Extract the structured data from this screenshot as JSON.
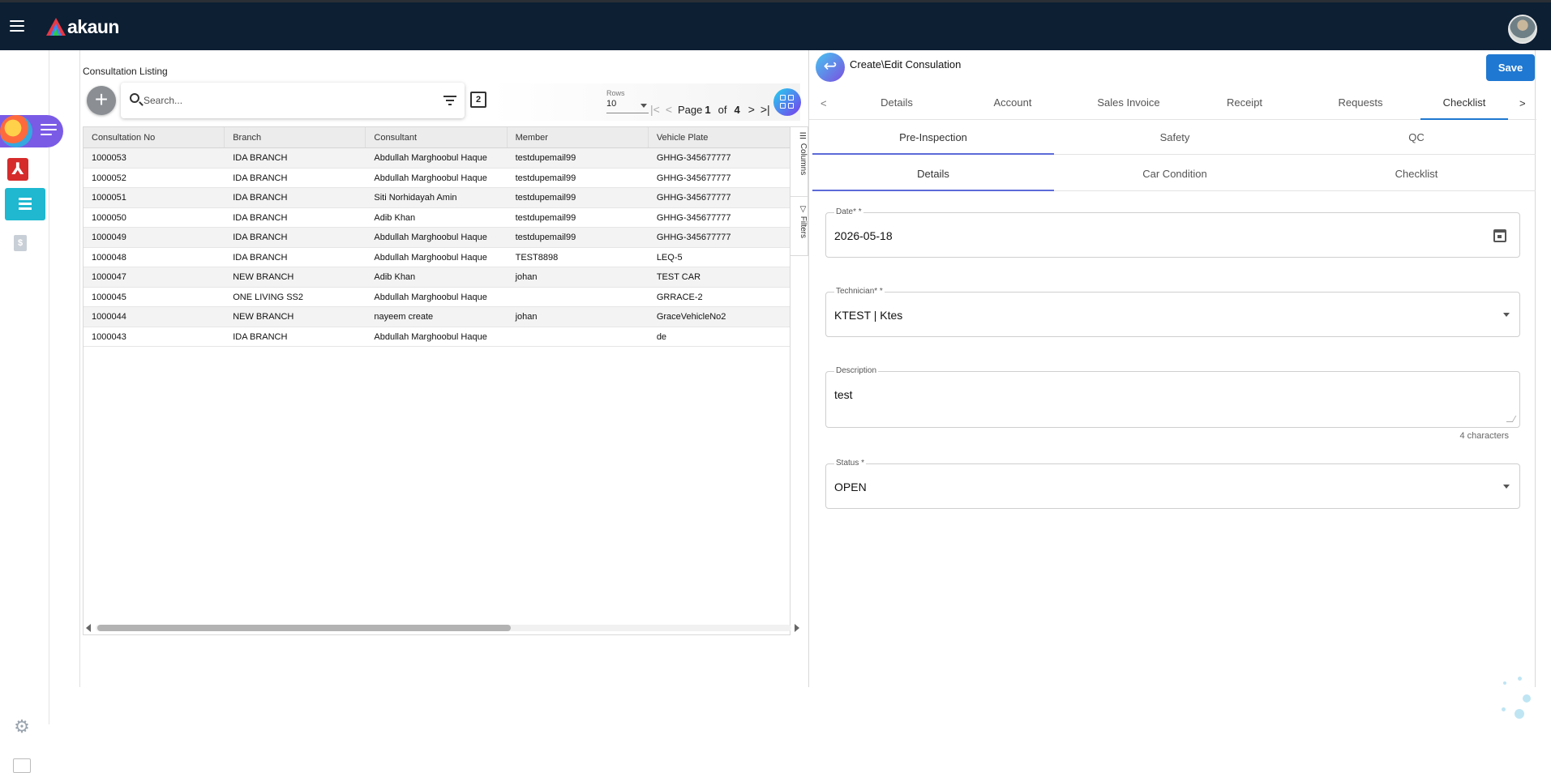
{
  "app": {
    "brand": "akaun",
    "avatar_alt": "user-avatar"
  },
  "rail": {
    "pdf_glyph": "⅄",
    "doc_glyph": "$",
    "gear_glyph": "⚙"
  },
  "listing": {
    "title": "Consultation Listing",
    "search_placeholder": "Search...",
    "copy_badge": "2",
    "rows_label": "Rows",
    "rows_value": "10",
    "page_label": "Page",
    "page_current": "1",
    "page_of": "of",
    "page_total": "4",
    "side_tools": [
      "Columns",
      "Filters"
    ],
    "columns": [
      "Consultation No",
      "Branch",
      "Consultant",
      "Member",
      "Vehicle Plate"
    ],
    "rows": [
      [
        "1000053",
        "IDA BRANCH",
        "Abdullah Marghoobul Haque",
        "testdupemail99",
        "GHHG-345677777"
      ],
      [
        "1000052",
        "IDA BRANCH",
        "Abdullah Marghoobul Haque",
        "testdupemail99",
        "GHHG-345677777"
      ],
      [
        "1000051",
        "IDA BRANCH",
        "Siti Norhidayah Amin",
        "testdupemail99",
        "GHHG-345677777"
      ],
      [
        "1000050",
        "IDA BRANCH",
        "Adib Khan",
        "testdupemail99",
        "GHHG-345677777"
      ],
      [
        "1000049",
        "IDA BRANCH",
        "Abdullah Marghoobul Haque",
        "testdupemail99",
        "GHHG-345677777"
      ],
      [
        "1000048",
        "IDA BRANCH",
        "Abdullah Marghoobul Haque",
        "TEST8898",
        "LEQ-5"
      ],
      [
        "1000047",
        "NEW BRANCH",
        "Adib Khan",
        "johan",
        "TEST CAR"
      ],
      [
        "1000045",
        "ONE LIVING SS2",
        "Abdullah Marghoobul Haque",
        "",
        "GRRACE-2"
      ],
      [
        "1000044",
        "NEW BRANCH",
        "nayeem create",
        "johan",
        "GraceVehicleNo2"
      ],
      [
        "1000043",
        "IDA BRANCH",
        "Abdullah Marghoobul Haque",
        "",
        "de"
      ]
    ]
  },
  "form": {
    "title": "Create\\Edit Consulation",
    "save_label": "Save",
    "tabs": [
      "Details",
      "Account",
      "Sales Invoice",
      "Receipt",
      "Requests",
      "Checklist"
    ],
    "active_tab": "Checklist",
    "subtabs_1": [
      "Pre-Inspection",
      "Safety",
      "QC"
    ],
    "subtabs_2": [
      "Details",
      "Car Condition",
      "Checklist"
    ],
    "date_label": "Date* *",
    "date_value": "2026-05-18",
    "technician_label": "Technician* *",
    "technician_value": "KTEST | Ktes",
    "description_label": "Description",
    "description_value": "test",
    "char_count": "4 characters",
    "status_label": "Status *",
    "status_value": "OPEN"
  },
  "colors": {
    "topbar": "#0c1f33",
    "accent": "#1f78d1",
    "rail_active": "#1fb8d0"
  }
}
